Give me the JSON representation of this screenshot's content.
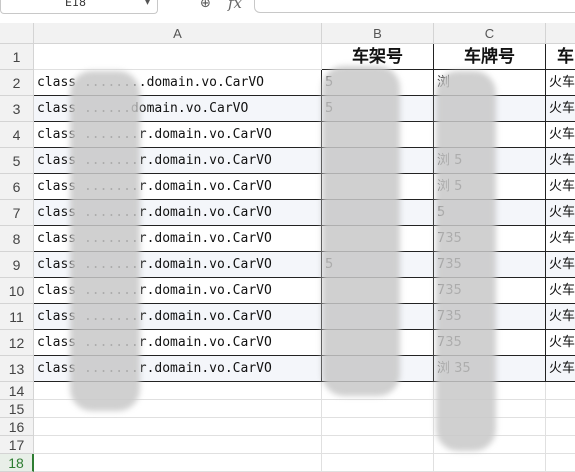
{
  "toolbar": {
    "cell_ref": "E18",
    "dropdown_glyph": "▾",
    "zoom_icon": "⊕",
    "fx": "fx",
    "formula": ""
  },
  "columns": [
    "A",
    "B",
    "C"
  ],
  "rows": [
    "1",
    "2",
    "3",
    "4",
    "5",
    "6",
    "7",
    "8",
    "9",
    "10",
    "11",
    "12",
    "13",
    "14",
    "15",
    "16",
    "17",
    "18"
  ],
  "active_row": "18",
  "header_row": {
    "B": "车架号",
    "C": "车牌号",
    "D": "车"
  },
  "data_rows": [
    {
      "A": "class ........domain.vo.CarVO",
      "B": "5",
      "C": "浏",
      "D": "火车"
    },
    {
      "A": "class ......domain.vo.CarVO",
      "B": "5",
      "C": "",
      "D": "火车"
    },
    {
      "A": "class .......r.domain.vo.CarVO",
      "B": "",
      "C": "",
      "D": "火车"
    },
    {
      "A": "class .......r.domain.vo.CarVO",
      "B": "",
      "C": "浏 5",
      "D": "火车"
    },
    {
      "A": "class .......r.domain.vo.CarVO",
      "B": "",
      "C": "浏 5",
      "D": "火车"
    },
    {
      "A": "class .......r.domain.vo.CarVO",
      "B": "",
      "C": "5",
      "D": "火车"
    },
    {
      "A": "class .......r.domain.vo.CarVO",
      "B": "",
      "C": "735",
      "D": "火车"
    },
    {
      "A": "class .......r.domain.vo.CarVO",
      "B": "5",
      "C": "735",
      "D": "火车"
    },
    {
      "A": "class .......r.domain.vo.CarVO",
      "B": "",
      "C": "735",
      "D": "火车"
    },
    {
      "A": "class .......r.domain.vo.CarVO",
      "B": "",
      "C": "735",
      "D": "火车"
    },
    {
      "A": "class .......r.domain.vo.CarVO",
      "B": "",
      "C": "735",
      "D": "火车"
    },
    {
      "A": "class .......r.domain.vo.CarVO",
      "B": "",
      "C": "浏 35",
      "D": "火车"
    }
  ]
}
